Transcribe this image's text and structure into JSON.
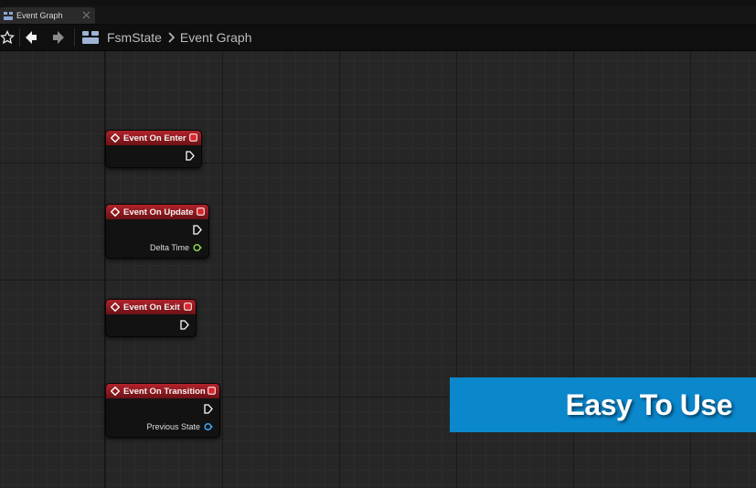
{
  "tab": {
    "label": "Event Graph"
  },
  "breadcrumb": {
    "root": "FsmState",
    "current": "Event Graph"
  },
  "nodes": [
    {
      "title": "Event On Enter",
      "pin": ""
    },
    {
      "title": "Event On Update",
      "pin": "Delta Time"
    },
    {
      "title": "Event On Exit",
      "pin": ""
    },
    {
      "title": "Event On Transition",
      "pin": "Previous State"
    }
  ],
  "colors": {
    "node_header": "#b2232a",
    "float_pin": "#8fd14f",
    "object_pin": "#3ea8f5",
    "banner": "#0b87cc"
  },
  "icons": [
    "graph-icon",
    "close-icon",
    "star-icon",
    "back-arrow-icon",
    "forward-arrow-icon",
    "blueprint-icon",
    "chevron-right-icon",
    "event-icon",
    "delegate-icon",
    "exec-pin-icon"
  ],
  "banner": {
    "text": "Easy To Use"
  }
}
